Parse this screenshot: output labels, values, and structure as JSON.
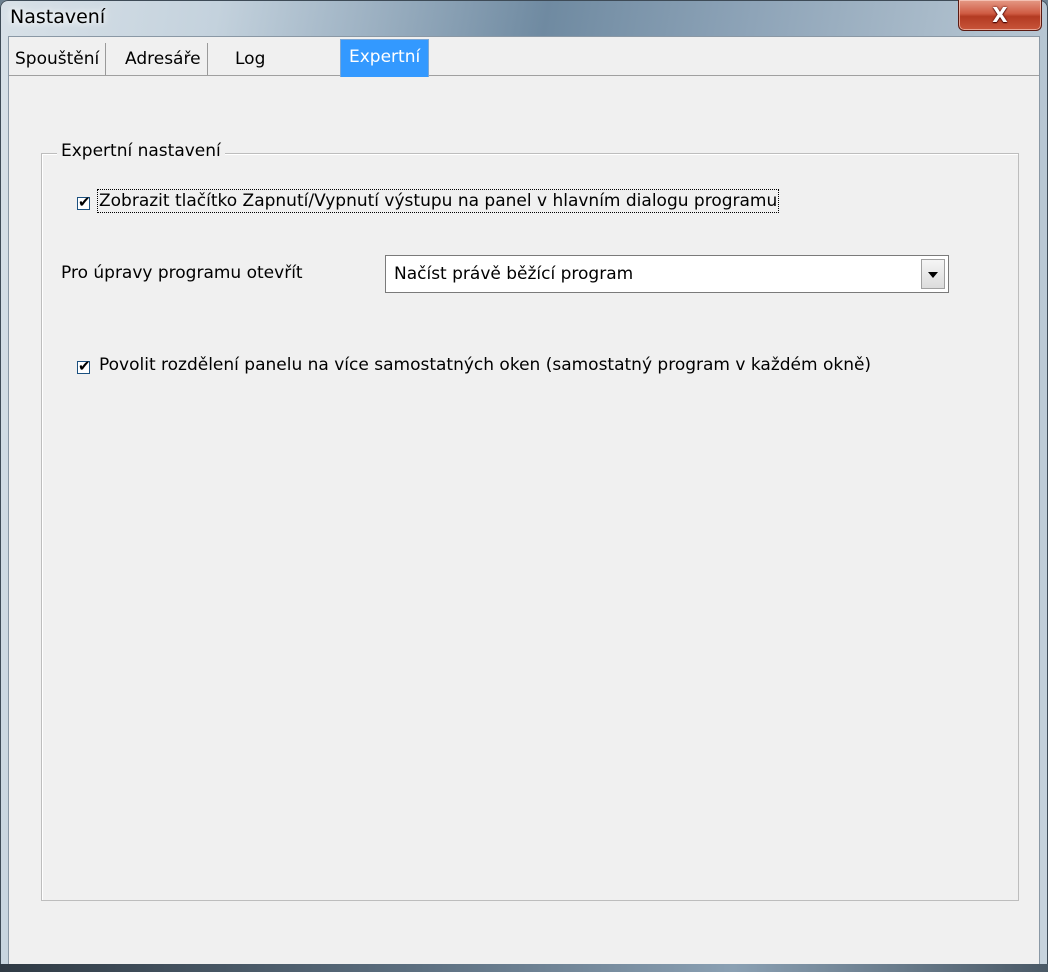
{
  "window": {
    "title": "Nastavení",
    "close_label": "X"
  },
  "tabs": [
    {
      "label": "Spouštění",
      "active": false
    },
    {
      "label": "Adresáře",
      "active": false
    },
    {
      "label": "Log",
      "active": false
    },
    {
      "label": "Expertní",
      "active": true
    }
  ],
  "group": {
    "title": "Expertní nastavení",
    "show_toggle_checkbox": {
      "label": "Zobrazit tlačítko Zapnutí/Vypnutí výstupu na panel   v hlavním dialogu programu",
      "checked": true
    },
    "open_for_edit": {
      "label": "Pro úpravy programu otevřít",
      "selected": "Načíst právě běžící program"
    },
    "split_panel_checkbox": {
      "label": "Povolit rozdělení panelu na více samostatných oken (samostatný program v každém okně)",
      "checked": true
    }
  },
  "colors": {
    "active_tab": "#3399ff",
    "dialog_background": "#f0f0f0"
  }
}
